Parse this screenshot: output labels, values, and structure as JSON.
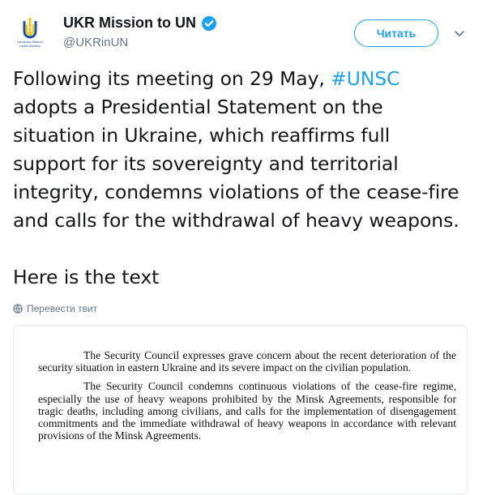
{
  "account": {
    "display_name": "UKR Mission to UN",
    "handle": "@UKRinUN",
    "verified": true,
    "avatar_icon": "ukraine-trident-icon",
    "avatar_caption_line1": "Ukrainian Mission",
    "avatar_caption_line2": "United Nations"
  },
  "actions": {
    "follow_label": "Читать",
    "more_icon": "chevron-down-icon"
  },
  "tweet": {
    "text_before_hashtag": "Following its meeting on 29 May, ",
    "hashtag": "#UNSC",
    "text_after_hashtag": " adopts a Presidential Statement on the situation in Ukraine, which reaffirms full support for its sovereignty and territorial integrity, condemns violations of the cease-fire and calls for the withdrawal of heavy weapons.",
    "second_paragraph": "Here is the text"
  },
  "translate": {
    "label": "Перевести твит",
    "icon": "globe-icon"
  },
  "document_image": {
    "paragraph1": "The Security Council expresses grave concern about the recent deterioration of the security situation in eastern Ukraine and its severe impact on the civilian population.",
    "paragraph2": "The Security Council condemns continuous violations of the cease-fire regime, especially the use of heavy weapons prohibited by the Minsk Agreements, responsible for tragic deaths, including among civilians, and calls for the implementation of disengagement commitments and the immediate withdrawal of heavy weapons in accordance with relevant provisions of the Minsk Agreements."
  },
  "colors": {
    "accent": "#1da1f2",
    "secondary_text": "#657786",
    "primary_text": "#14171a",
    "border": "#e1e8ed",
    "trident_blue": "#1c4fa0",
    "trident_yellow": "#f5c518"
  }
}
